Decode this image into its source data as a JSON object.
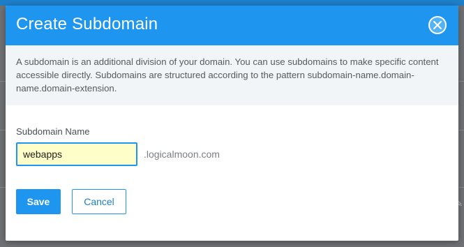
{
  "dialog": {
    "title": "Create Subdomain",
    "description": "A subdomain is an additional division of your domain. You can use subdomains to make specific content accessible directly. Subdomains are structured according to the pattern subdomain-name.domain-name.domain-extension.",
    "field_label": "Subdomain Name",
    "input_value": "webapps",
    "domain_suffix": ".logicalmoon.com",
    "save_label": "Save",
    "cancel_label": "Cancel",
    "close_icon": "close-icon"
  },
  "colors": {
    "accent": "#1e96f0",
    "input_background": "#fdfec8",
    "info_background": "#f2f5f7"
  }
}
